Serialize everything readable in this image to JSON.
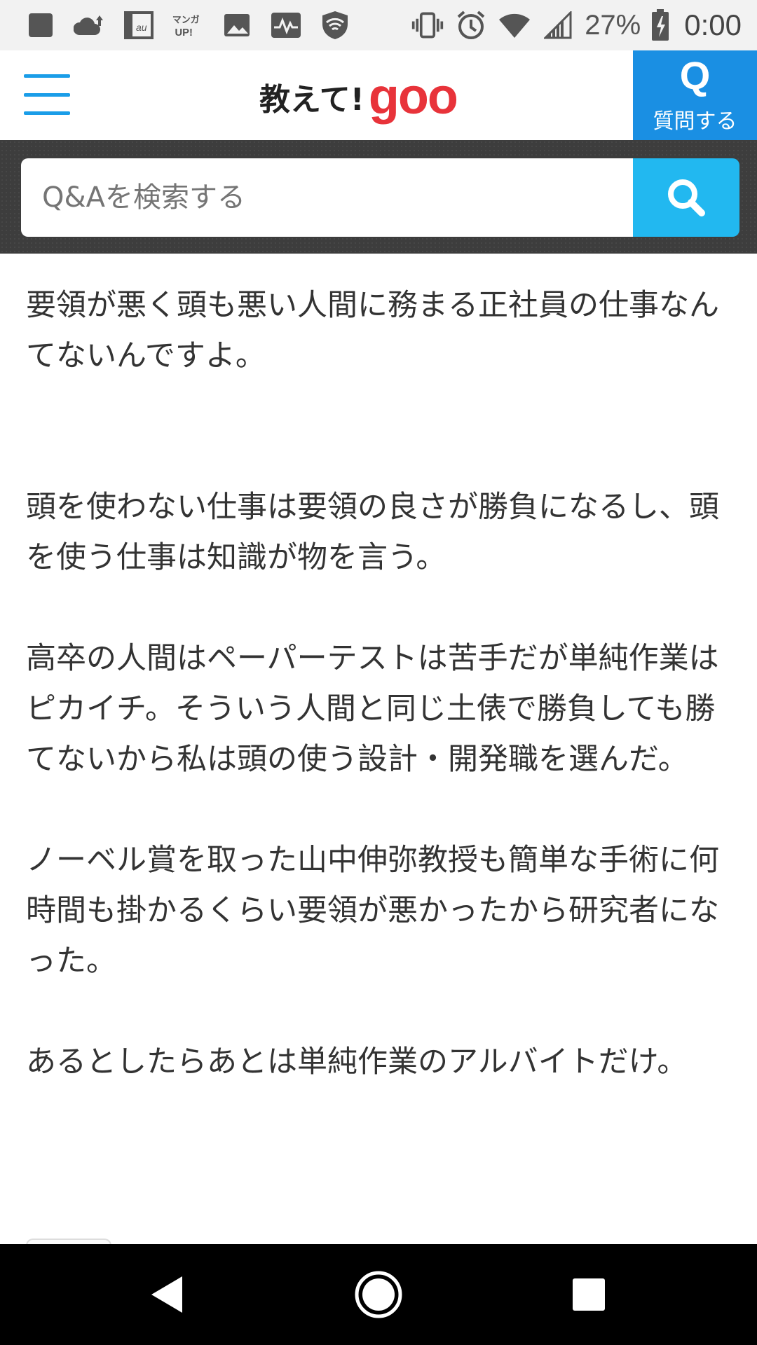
{
  "status_bar": {
    "left_icons": [
      "notification-square-icon",
      "cloud-upload-icon",
      "au-app-icon",
      "manga-up-icon",
      "image-icon",
      "activity-icon",
      "shield-icon"
    ],
    "manga_up_label": "マンガ UP!",
    "au_label": "au",
    "battery_percent": "27%",
    "time": "0:00"
  },
  "header": {
    "logo_jp": "教えて!",
    "logo_goo": "goo",
    "ask_icon": "Q",
    "ask_label": "質問する"
  },
  "search": {
    "placeholder": "Q&Aを検索する"
  },
  "content": {
    "paragraphs": [
      "要領が悪く頭も悪い人間に務まる正社員の仕事なんてないんですよ。",
      "頭を使わない仕事は要領の良さが勝負になるし、頭を使う仕事は知識が物を言う。",
      "高卒の人間はペーパーテストは苦手だが単純作業はピカイチ。そういう人間と同じ土俵で勝負しても勝てないから私は頭の使う設計・開発職を選んだ。",
      "ノーベル賞を取った山中伸弥教授も簡単な手術に何時間も掛かるくらい要領が悪かったから研究者になった。",
      "あるとしたらあとは単純作業のアルバイトだけ。"
    ]
  },
  "nav": {
    "back_icon": "back-triangle-icon",
    "home_icon": "home-circle-icon",
    "recents_icon": "recents-square-icon"
  },
  "colors": {
    "accent_blue": "#1a8fe3",
    "search_button": "#22b8f0",
    "logo_red": "#e8333a",
    "search_band": "#3d3d3d"
  }
}
